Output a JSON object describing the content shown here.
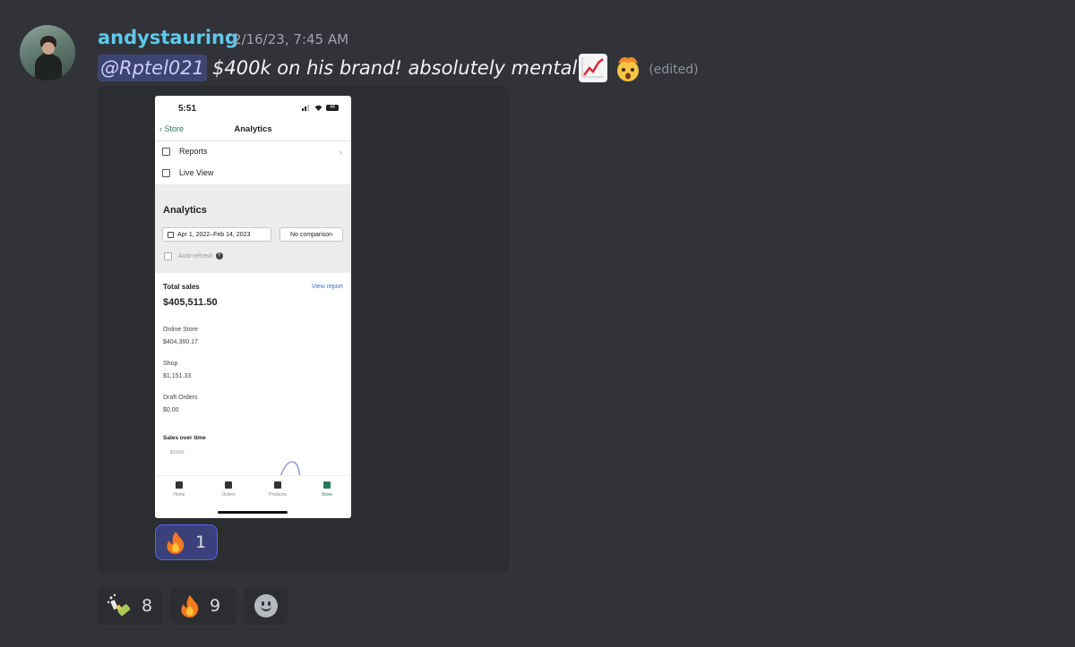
{
  "message": {
    "username": "andystauring",
    "timestamp": "2/16/23, 7:45 AM",
    "mention": "@Rptel021",
    "text": "$400k on his brand! absolutely mental",
    "edited": "(edited)",
    "emojis": [
      "chart-increasing-icon",
      "exploding-head-icon"
    ]
  },
  "phone": {
    "time": "5:51",
    "battery": "44",
    "back_label": "Store",
    "title": "Analytics",
    "menu": [
      {
        "label": "Reports",
        "icon": "report-icon"
      },
      {
        "label": "Live View",
        "icon": "live-view-icon"
      }
    ],
    "section_title": "Analytics",
    "date_range": "Apr 1, 2022–Feb 14, 2023",
    "comparison": "No comparison",
    "auto_refresh": "Auto-refresh",
    "total_sales_label": "Total sales",
    "view_report": "View report",
    "total_sales_value": "$405,511.50",
    "channels": [
      {
        "label": "Online Store",
        "value": "$404,360.17"
      },
      {
        "label": "Shop",
        "value": "$1,151.33"
      },
      {
        "label": "Draft Orders",
        "value": "$0.00"
      }
    ],
    "sales_over_time": "Sales over time",
    "axis_top": "$100K",
    "tabs": [
      {
        "label": "Home",
        "active": false
      },
      {
        "label": "Orders",
        "active": false
      },
      {
        "label": "Products",
        "active": false
      },
      {
        "label": "Store",
        "active": true
      }
    ]
  },
  "inner_reaction": {
    "emoji": "fire-icon",
    "count": "1"
  },
  "reactions": [
    {
      "emoji": "champagne-icon",
      "count": "8"
    },
    {
      "emoji": "fire-icon",
      "count": "9"
    },
    {
      "emoji": "add-reaction-icon",
      "count": ""
    }
  ],
  "colors": {
    "background": "#313338",
    "username": "#5ec9ec",
    "mention_bg": "#3e4470",
    "reaction_active_border": "#5865f2",
    "shopify_green": "#2a7b5d"
  }
}
